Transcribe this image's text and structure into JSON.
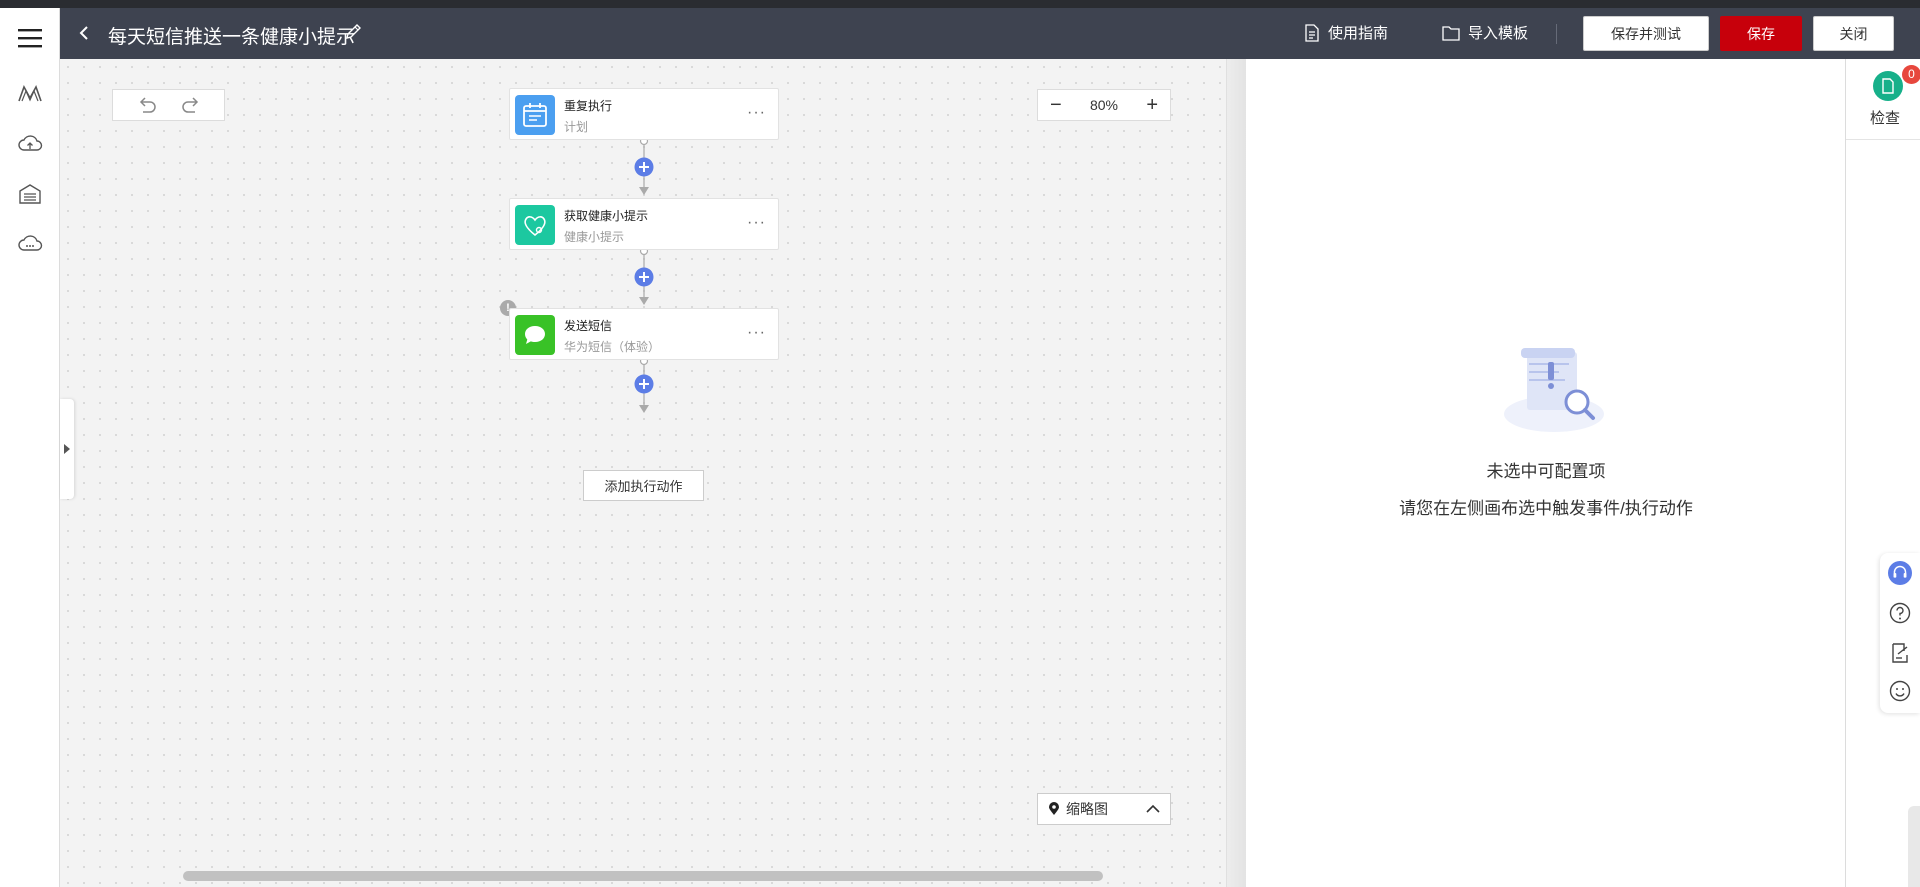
{
  "header": {
    "title": "每天短信推送一条健康小提示",
    "guide_label": "使用指南",
    "import_label": "导入模板",
    "save_test_label": "保存并测试",
    "save_label": "保存",
    "close_label": "关闭"
  },
  "sidebar": {
    "icons": [
      "menu-icon",
      "logo-icon",
      "cloud-upload-icon",
      "warehouse-icon",
      "cloud-icon"
    ]
  },
  "canvas": {
    "zoom": "80%",
    "nodes": [
      {
        "title": "重复执行",
        "subtitle": "计划",
        "icon": "calendar-icon",
        "color": "#4b9ff0"
      },
      {
        "title": "获取健康小提示",
        "subtitle": "健康小提示",
        "icon": "health-heart-icon",
        "color": "#1cc8a0"
      },
      {
        "title": "发送短信",
        "subtitle": "华为短信（体验）",
        "icon": "message-icon",
        "color": "#39c227"
      }
    ],
    "add_action_label": "添加执行动作",
    "minimap_label": "缩略图",
    "connector_color": "#5c7de6"
  },
  "right_panel": {
    "empty_title": "未选中可配置项",
    "empty_desc": "请您在左侧画布选中触发事件/执行动作"
  },
  "right_col": {
    "check_label": "检查",
    "check_count": "0"
  },
  "colors": {
    "header_bg": "#3e4350",
    "primary": "#c7000b",
    "check": "#17b08a",
    "badge": "#e7473d"
  }
}
